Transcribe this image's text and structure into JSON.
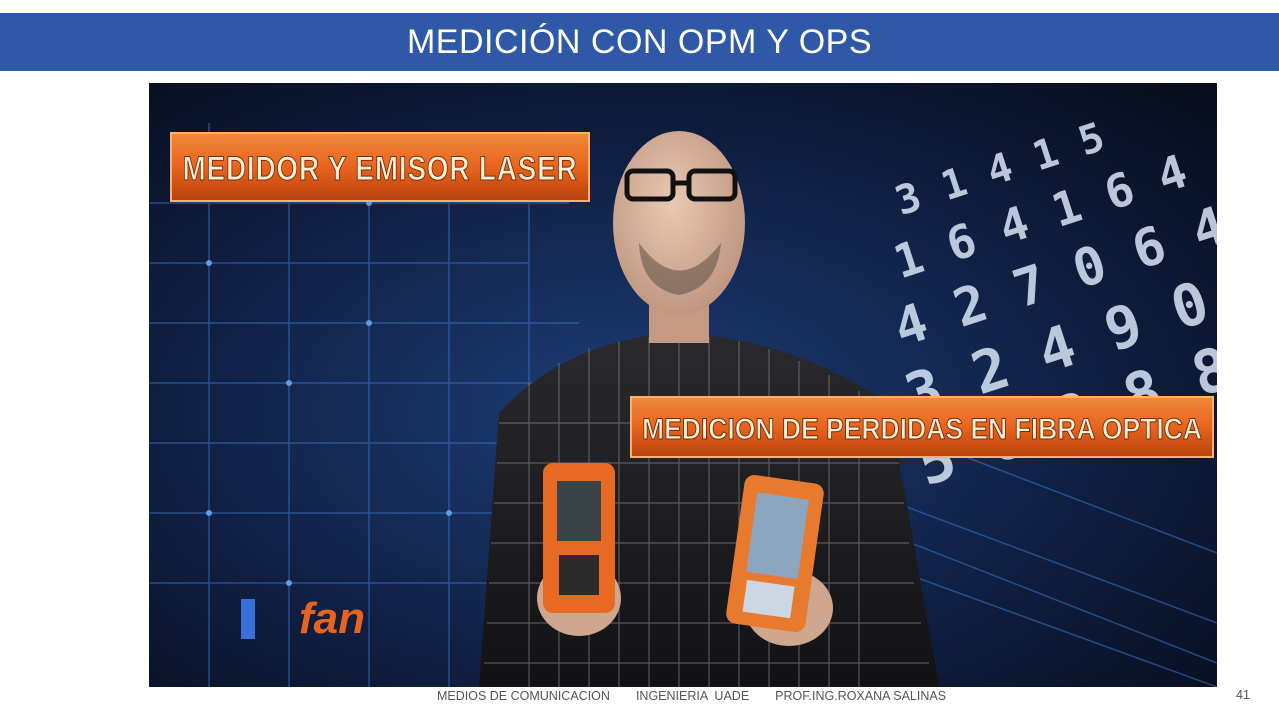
{
  "slide": {
    "title": "MEDICIÓN CON OPM Y OPS",
    "page_number": "41",
    "footer": {
      "course": "MEDIOS DE COMUNICACION",
      "institution": "INGENIERIA  UADE",
      "professor": "PROF.ING.ROXANA SALINAS"
    },
    "colors": {
      "title_bar": "#2f59a7",
      "title_text": "#ffffff",
      "banner_orange": "#e8641e"
    }
  },
  "video": {
    "banner_top": "MEDIDOR Y EMISOR LASER",
    "banner_bottom": "MEDICION DE PERDIDAS EN FIBRA OPTICA",
    "logo_text": "fan"
  }
}
